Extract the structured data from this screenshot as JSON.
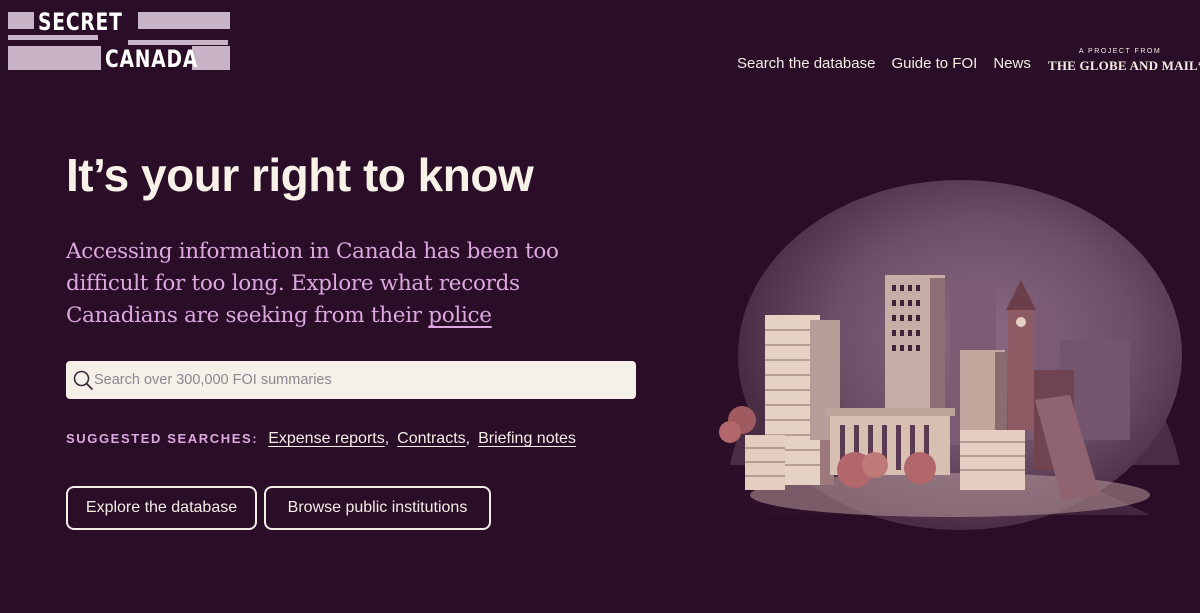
{
  "logo": {
    "line1": "SECRET",
    "line2": "CANADA"
  },
  "nav": {
    "items": [
      {
        "label": "Search the database"
      },
      {
        "label": "Guide to FOI"
      },
      {
        "label": "News"
      }
    ]
  },
  "publisher": {
    "tagline": "A PROJECT FROM",
    "name": "THE GLOBE AND MAIL*"
  },
  "hero": {
    "headline": "It’s your right to know",
    "lede_prefix": "Accessing information in Canada has been too difficult for too long. Explore what records Canadians are seeking from their ",
    "lede_link": "police"
  },
  "search": {
    "placeholder": "Search over 300,000 FOI summaries",
    "value": ""
  },
  "suggested": {
    "label": "SUGGESTED SEARCHES:",
    "items": [
      "Expense reports",
      "Contracts",
      "Briefing notes"
    ],
    "separator": ","
  },
  "actions": {
    "explore_label": "Explore the database",
    "browse_label": "Browse public institutions"
  },
  "colors": {
    "background": "#2a0d27",
    "accent": "#dca8df",
    "text": "#f3ede6",
    "input_bg": "#f6f1e8"
  },
  "icons": {
    "search": "search-icon",
    "illustration": "city-buildings-illustration"
  }
}
